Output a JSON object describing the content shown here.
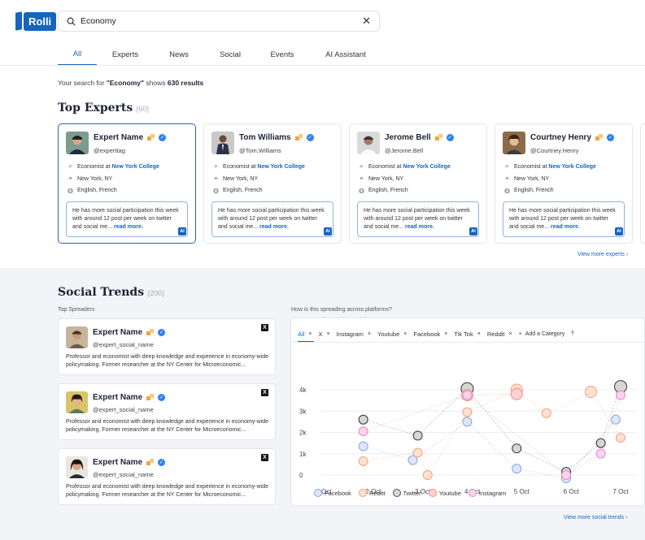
{
  "brand": {
    "name": "Rolli"
  },
  "search": {
    "query": "Economy"
  },
  "tabs": [
    {
      "label": "All",
      "active": true
    },
    {
      "label": "Experts"
    },
    {
      "label": "News"
    },
    {
      "label": "Social"
    },
    {
      "label": "Events"
    },
    {
      "label": "AI Assistant"
    }
  ],
  "results": {
    "prefix": "Your search for ",
    "term": "\"Economy\"",
    "middle": " shows ",
    "count": "630 results"
  },
  "top_experts": {
    "title": "Top Experts",
    "count": "(60)",
    "view_more": "View more experts",
    "experts": [
      {
        "name": "Expert Name",
        "handle": "@experttag",
        "role_prefix": "Economist at ",
        "org": "New York College",
        "location": "New York, NY",
        "languages": "English, French",
        "summary": "He has more social participation this week with around 12 post per week on twitter and social me...",
        "read_more": "read more.",
        "ai": "AI"
      },
      {
        "name": "Tom Williams",
        "handle": "@Tom.Williams",
        "role_prefix": "Economist at ",
        "org": "New York College",
        "location": "New York, NY",
        "languages": "English, French",
        "summary": "He has more social participation this week with around 12 post per week on twitter and social me...",
        "read_more": "read more.",
        "ai": "AI"
      },
      {
        "name": "Jerome Bell",
        "handle": "@Jerome.Bell",
        "role_prefix": "Economist at ",
        "org": "New York College",
        "location": "New York, NY",
        "languages": "English, French",
        "summary": "He has more social participation this week with around 12 post per week on twitter and social me...",
        "read_more": "read more.",
        "ai": "AI"
      },
      {
        "name": "Courtney Henry",
        "handle": "@Courtney.Henry",
        "role_prefix": "Economist at ",
        "org": "New York College",
        "location": "New York, NY",
        "languages": "English, French",
        "summary": "He has more social participation this week with around 12 post per week on twitter and social me...",
        "read_more": "read more.",
        "ai": "AI"
      }
    ]
  },
  "social_trends": {
    "title": "Social Trends",
    "count": "(200)",
    "spreaders_label": "Top Spreaders",
    "chart_label": "How is this spreading across platforms?",
    "view_more": "View more social trends",
    "spreaders": [
      {
        "name": "Expert Name",
        "handle": "@expert_social_name",
        "desc": "Professor and economist with deep knowledge and experience in economy-wide policymaking. Former researcher at the NY Center for Microeconomic...",
        "platform": "X"
      },
      {
        "name": "Expert Name",
        "handle": "@expert_social_name",
        "desc": "Professor and economist with deep knowledge and experience in economy-wide policymaking. Former researcher at the NY Center for Microeconomic...",
        "platform": "X"
      },
      {
        "name": "Expert Name",
        "handle": "@expert_social_name",
        "desc": "Professor and economist with deep knowledge and experience in economy-wide policymaking. Former researcher at the NY Center for Microeconomic...",
        "platform": "X"
      }
    ],
    "chart_tabs": [
      {
        "label": "All",
        "active": true
      },
      {
        "label": "X"
      },
      {
        "label": "Instagram"
      },
      {
        "label": "Youtube"
      },
      {
        "label": "Facebook"
      },
      {
        "label": "Tik Tok"
      },
      {
        "label": "Reddit"
      }
    ],
    "add_category": "Add a Category"
  },
  "chart_data": {
    "type": "scatter",
    "x": [
      "1 Oct",
      "2 Oct",
      "3 Oct",
      "4 Oct",
      "5 Oct",
      "6 Oct",
      "7 Oct"
    ],
    "y_ticks": [
      "0",
      "1k",
      "2k",
      "3k",
      "4k"
    ],
    "ylim": [
      0,
      4000
    ],
    "series": [
      {
        "name": "Facebook",
        "color": "#8aa4dc",
        "points": [
          [
            1.8,
            1350
          ],
          [
            2.8,
            700
          ],
          [
            3.9,
            2500
          ],
          [
            4.9,
            300
          ],
          [
            5.9,
            -150
          ],
          [
            6.9,
            2600
          ]
        ]
      },
      {
        "name": "Reditt",
        "color": "#f4a07a",
        "points": [
          [
            1.8,
            650
          ],
          [
            2.9,
            1050
          ],
          [
            3.1,
            0
          ],
          [
            3.9,
            2950
          ],
          [
            4.9,
            4000
          ],
          [
            5.5,
            2900
          ],
          [
            6.4,
            3900
          ],
          [
            7.0,
            1750
          ]
        ]
      },
      {
        "name": "Twitter",
        "color": "#666666",
        "points": [
          [
            1.8,
            2600
          ],
          [
            2.9,
            1850
          ],
          [
            3.9,
            4050
          ],
          [
            4.9,
            1250
          ],
          [
            5.9,
            150
          ],
          [
            6.6,
            1500
          ],
          [
            7.0,
            4150
          ]
        ]
      },
      {
        "name": "Youtube",
        "color": "#f28b82",
        "points": [
          [
            3.9,
            3750
          ],
          [
            4.9,
            3800
          ]
        ]
      },
      {
        "name": "Instagram",
        "color": "#e985c9",
        "points": [
          [
            1.8,
            2050
          ],
          [
            3.9,
            3750
          ],
          [
            5.9,
            0
          ],
          [
            6.6,
            1000
          ],
          [
            7.0,
            3750
          ]
        ]
      }
    ]
  }
}
